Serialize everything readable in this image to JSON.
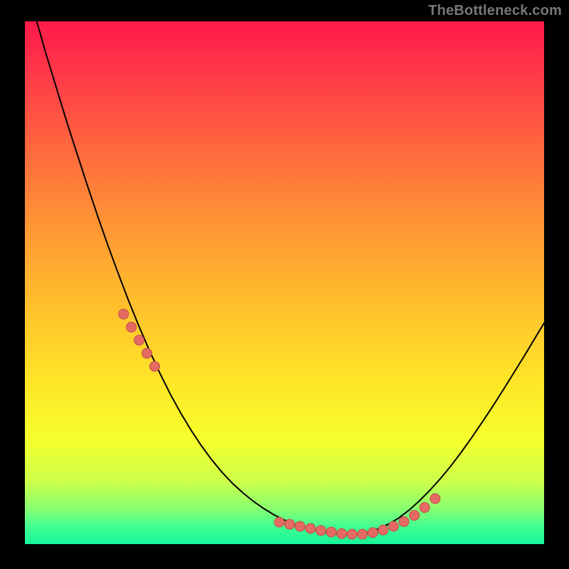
{
  "attribution": "TheBottleneck.com",
  "colors": {
    "page_bg": "#000000",
    "attribution_text": "#777777",
    "curve": "#000000",
    "marker_fill": "#e46a63",
    "marker_stroke": "#c64c47",
    "gradient_stops": [
      {
        "offset": "0%",
        "color": "#ff1a4b"
      },
      {
        "offset": "12%",
        "color": "#ff3f47"
      },
      {
        "offset": "30%",
        "color": "#ff7a3a"
      },
      {
        "offset": "50%",
        "color": "#ffb52e"
      },
      {
        "offset": "68%",
        "color": "#ffe327"
      },
      {
        "offset": "80%",
        "color": "#f6ff2c"
      },
      {
        "offset": "88%",
        "color": "#ccff4a"
      },
      {
        "offset": "93%",
        "color": "#8bff6e"
      },
      {
        "offset": "97%",
        "color": "#3bff95"
      },
      {
        "offset": "100%",
        "color": "#17f59a"
      }
    ]
  },
  "chart_data": {
    "type": "line",
    "title": "",
    "xlabel": "",
    "ylabel": "",
    "xlim": [
      0,
      100
    ],
    "ylim": [
      0,
      100
    ],
    "x": [
      0,
      2,
      4,
      6,
      8,
      10,
      12,
      14,
      16,
      18,
      20,
      22,
      24,
      26,
      28,
      30,
      32,
      34,
      36,
      38,
      40,
      42,
      44,
      46,
      48,
      50,
      52,
      54,
      56,
      58,
      60,
      62,
      64,
      66,
      68,
      70,
      72,
      74,
      76,
      78,
      80,
      82,
      84,
      86,
      88,
      90,
      92,
      94,
      96,
      98,
      100
    ],
    "values": [
      108,
      101,
      94,
      87.5,
      81,
      74.8,
      68.7,
      62.8,
      57.1,
      51.7,
      46.5,
      41.6,
      37,
      32.7,
      28.7,
      25.1,
      21.8,
      18.8,
      16.1,
      13.7,
      11.6,
      9.8,
      8.2,
      6.8,
      5.6,
      4.6,
      3.8,
      3.1,
      2.6,
      2.2,
      1.9,
      1.8,
      1.9,
      2.3,
      2.9,
      3.8,
      5,
      6.5,
      8.3,
      10.3,
      12.5,
      14.9,
      17.5,
      20.3,
      23.2,
      26.2,
      29.3,
      32.5,
      35.7,
      39,
      42.3
    ],
    "markers_x": [
      19,
      20.5,
      22,
      23.5,
      25,
      49,
      51,
      53,
      55,
      57,
      59,
      61,
      63,
      65,
      67,
      69,
      71,
      73,
      75,
      77,
      79
    ],
    "markers_y": [
      44,
      41.5,
      39,
      36.5,
      34,
      4.2,
      3.8,
      3.4,
      3.0,
      2.6,
      2.3,
      2.0,
      1.9,
      1.9,
      2.2,
      2.7,
      3.4,
      4.3,
      5.5,
      7.0,
      8.7
    ],
    "marker_radius_px": 7
  }
}
